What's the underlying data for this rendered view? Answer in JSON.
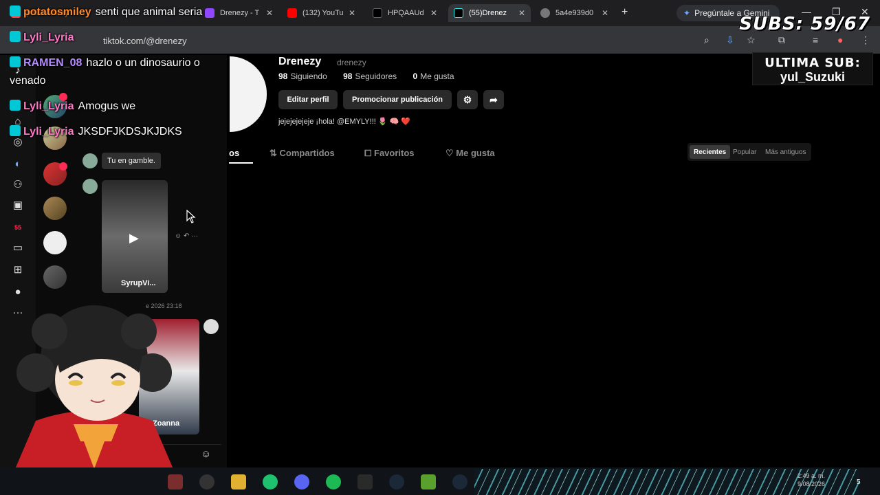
{
  "browser": {
    "tabs": [
      {
        "label": "potatosmiley",
        "active": false
      },
      {
        "label": "Drenezy - T",
        "active": false
      },
      {
        "label": "(132) YouTu",
        "active": false
      },
      {
        "label": "HPQAAUd",
        "active": false
      },
      {
        "label": "(55)Drenez",
        "active": true
      },
      {
        "label": "5a4e939d0",
        "active": false
      }
    ],
    "new_tab": "+",
    "gemini": "Pregúntale a Gemini",
    "url": "tiktok.com/@drenezy"
  },
  "overlay": {
    "subs": "SUBS: 59/67",
    "last_sub_title": "ULTIMA SUB:",
    "last_sub_name": "yul_Suzuki"
  },
  "chat": [
    {
      "user": "potatosmiley",
      "text": "senti que animal seria",
      "user_color": "#ff8a2a"
    },
    {
      "user": "Lyli_Lyria",
      "text": "",
      "user_color": "#ff7ac6"
    },
    {
      "user": "RAMEN_08",
      "text": "hazlo o un dinosaurio o",
      "user_color": "#b48cff"
    },
    {
      "user": "",
      "text": "venado",
      "user_color": "#ffffff"
    },
    {
      "user": "Lyli_Lyria",
      "text": "Amogus we",
      "user_color": "#ff7ac6"
    },
    {
      "user": "Lyli_Lyria",
      "text": "JKSDFJKDSJKJDKS",
      "user_color": "#ff7ac6"
    }
  ],
  "sidebar": {
    "badge_count": "55",
    "more": "···"
  },
  "messages": {
    "bubble": "Tu en gamble.",
    "video1_label": "SyrupVi...",
    "timestamp": "e 2026 23:18",
    "video2_label": "Zoanna"
  },
  "profile": {
    "name": "Drenezy",
    "handle": "drenezy",
    "following_count": "98",
    "following_label": "Siguiendo",
    "followers_count": "98",
    "followers_label": "Seguidores",
    "likes_count": "0",
    "likes_label": "Me gusta",
    "edit_profile": "Editar perfil",
    "promote": "Promocionar publicación",
    "bio": "jejejejejeje ¡hola! @EMYLY!!! 🌷 🧠 ❤️",
    "tabs": [
      "os",
      "Compartidos",
      "Favoritos",
      "Me gusta"
    ],
    "sort": [
      "Recientes",
      "Popular",
      "Más antiguos"
    ]
  },
  "taskbar": {
    "time": "2:49 a. m.",
    "date": "9/08/2026",
    "notif_count": "5"
  },
  "colors": {
    "accent": "#fe2c55",
    "tiktok_cyan": "#25f4ee"
  }
}
